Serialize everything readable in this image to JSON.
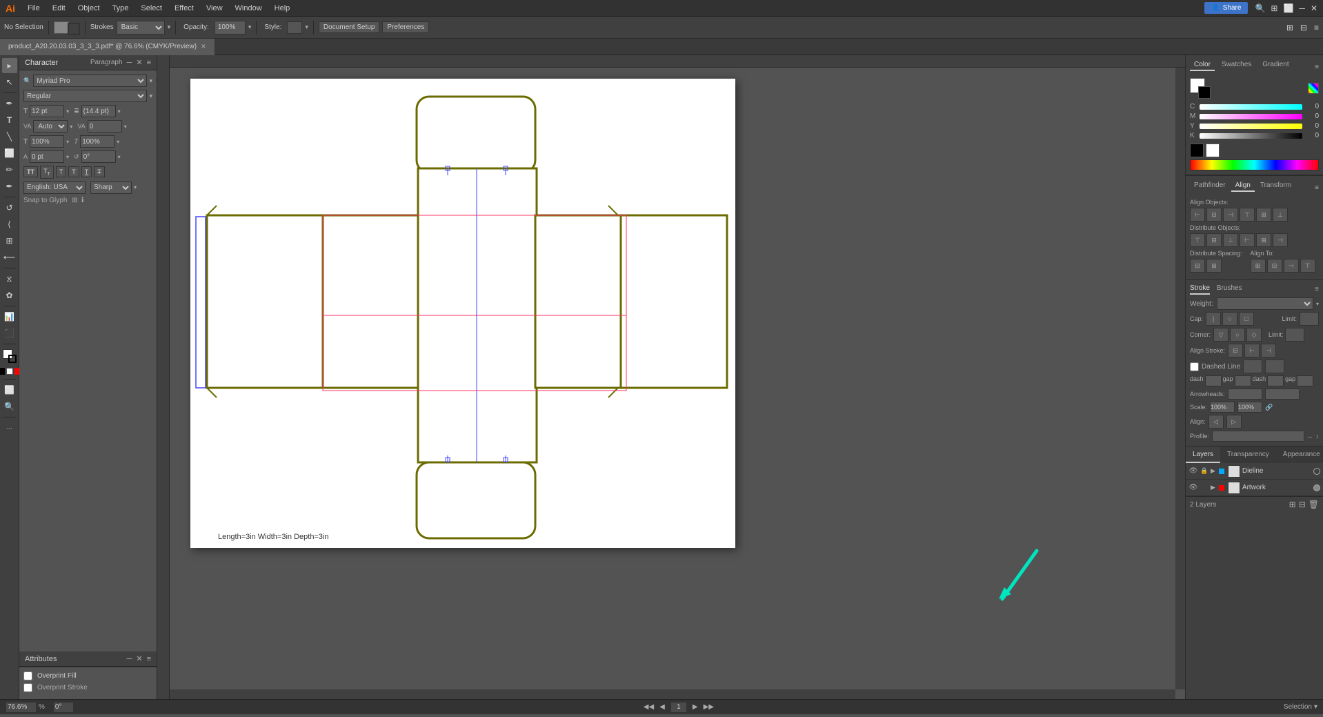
{
  "app": {
    "title": "Adobe Illustrator",
    "share_label": "Share"
  },
  "menu": {
    "items": [
      "File",
      "Edit",
      "Object",
      "Type",
      "Select",
      "Effect",
      "View",
      "Window",
      "Help"
    ]
  },
  "toolbar": {
    "selection": "No Selection",
    "fill_color": "#888888",
    "stroke_label": "Strokes",
    "stroke_value": "Basic",
    "opacity_label": "Opacity:",
    "opacity_value": "100%",
    "style_label": "Style:",
    "doc_setup": "Document Setup",
    "preferences": "Preferences"
  },
  "tab": {
    "filename": "product_A20.20.03.03_3_3_3.pdf*",
    "zoom": "76.6%",
    "mode": "CMYK/Preview"
  },
  "tools": {
    "list": [
      "▸",
      "↖",
      "✏",
      "✒",
      "⬜",
      "⭕",
      "✂",
      "⌖",
      "A",
      "↺",
      "◆",
      "⟨",
      "☰",
      "🔍",
      "⊞",
      "⋯"
    ]
  },
  "character_panel": {
    "title": "Character",
    "paragraph_tab": "Paragraph",
    "font_family": "Myriad Pro",
    "font_style": "Regular",
    "font_size": "12 pt",
    "leading": "(14.4 pt)",
    "tracking": "0",
    "kerning": "Auto",
    "horiz_scale": "100%",
    "vert_scale": "100%",
    "baseline_shift": "0 pt",
    "rotation": "0°",
    "language": "English: USA",
    "anti_alias": "Sharp",
    "snap_glyph": "Snap to Glyph",
    "style_buttons": [
      "TT",
      "T",
      "T",
      "T",
      "T",
      "T"
    ]
  },
  "attributes_panel": {
    "title": "Attributes",
    "overprint_fill": "Overprint Fill",
    "overprint_stroke": "Overprint Stroke"
  },
  "canvas": {
    "label": "Length=3in Width=3in Depth=3in",
    "bg_color": "#ffffff"
  },
  "color_panel": {
    "title": "Color",
    "tabs": [
      "Color",
      "Swatches",
      "Gradient"
    ],
    "active_tab": "Color",
    "c_value": "0",
    "m_value": "0",
    "y_value": "0",
    "k_value": "0"
  },
  "align_panel": {
    "title": "Align",
    "tabs": [
      "Pathfinder",
      "Align",
      "Transform"
    ],
    "active_tab": "Align",
    "align_objects_label": "Align Objects:",
    "distribute_objects_label": "Distribute Objects:",
    "distribute_spacing_label": "Distribute Spacing:",
    "align_to_label": "Align To:"
  },
  "stroke_panel": {
    "title": "Stroke",
    "brushes_tab": "Brushes",
    "weight_label": "Weight:",
    "cap_label": "Cap:",
    "corner_label": "Corner:",
    "limit_label": "Limit:",
    "align_stroke_label": "Align Stroke:",
    "dashed_line_label": "Dashed Line",
    "arrowheads_label": "Arrowheads:",
    "scale_label": "Scale:",
    "align_label": "Align:",
    "profile_label": "Profile:"
  },
  "layers_panel": {
    "title": "Layers",
    "tabs": [
      "Layers",
      "Transparency",
      "Appearance"
    ],
    "active_tab": "Layers",
    "count_label": "2 Layers",
    "layers": [
      {
        "name": "Dieline",
        "color": "#00aaff",
        "visible": true,
        "locked": false
      },
      {
        "name": "Artwork",
        "color": "#ff0000",
        "visible": true,
        "locked": false
      }
    ]
  },
  "status_bar": {
    "zoom_value": "76.6%",
    "rotation_value": "0°",
    "mode_label": "Selection",
    "page_nav": "1"
  }
}
